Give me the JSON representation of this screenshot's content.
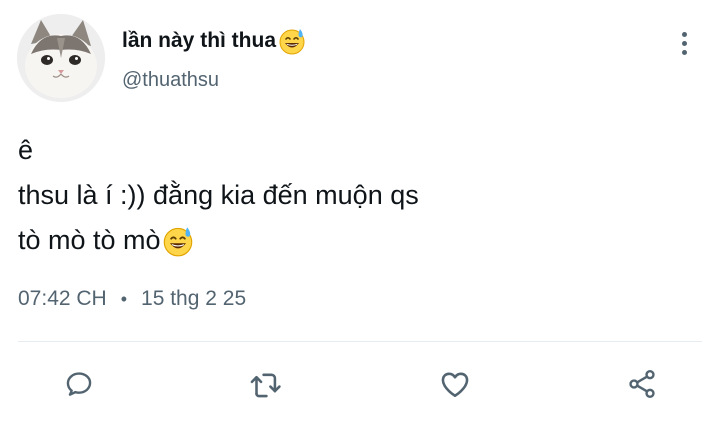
{
  "user": {
    "display_name": "lần này thì thua",
    "handle": "@thuathsu"
  },
  "tweet": {
    "lines": [
      "ê",
      "thsu là í :)) đằng kia đến muộn qs",
      "tò mò tò mò"
    ],
    "time": "07:42 CH",
    "date": "15 thg 2 25"
  },
  "icons": {
    "more": "more-vertical-icon",
    "reply": "reply-icon",
    "retweet": "retweet-icon",
    "like": "like-icon",
    "share": "share-icon"
  },
  "colors": {
    "text": "#0f1419",
    "secondary": "#536471",
    "divider": "#e6ecf0"
  }
}
